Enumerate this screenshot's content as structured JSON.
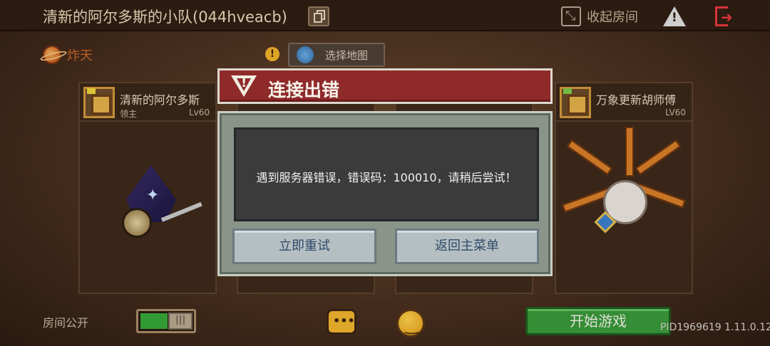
{
  "topbar": {
    "team_title": "清新的阿尔多斯的小队(044hveacb)",
    "collapse_label": "收起房间"
  },
  "mode": {
    "label": "炸天"
  },
  "map_button": {
    "label": "选择地图"
  },
  "players": [
    {
      "name": "清新的阿尔多斯",
      "role": "领主",
      "level": "Lv60"
    },
    {
      "name": "万象更新胡师傅",
      "role": "",
      "level": "LV60"
    }
  ],
  "bottom": {
    "room_public_label": "房间公开",
    "start_label": "开始游戏",
    "version": "PID1969619 1.11.0.12"
  },
  "dialog": {
    "title": "连接出错",
    "message": "遇到服务器错误，错误码：100010，请稍后尝试！",
    "retry_label": "立即重试",
    "menu_label": "返回主菜单"
  },
  "colors": {
    "dialog_header": "#8f2a2a",
    "start_button": "#3a9a3a",
    "toggle_on": "#37a83a"
  },
  "icons": [
    "copy-icon",
    "collapse-icon",
    "warning-icon",
    "exit-icon",
    "planet-icon",
    "notice-icon",
    "map-icon",
    "chat-icon",
    "emoji-icon"
  ]
}
